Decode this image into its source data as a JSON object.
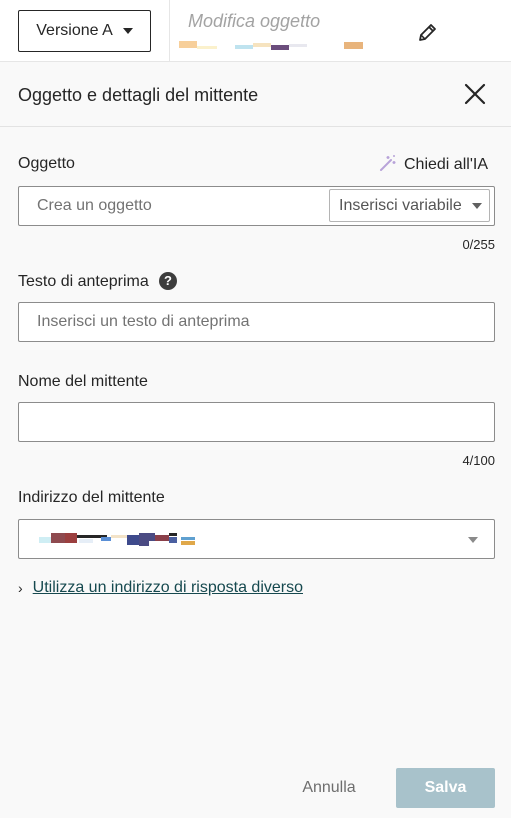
{
  "topbar": {
    "version_label": "Versione A",
    "subject_preview": "Modifica oggetto"
  },
  "panel": {
    "title": "Oggetto e dettagli del mittente"
  },
  "subject": {
    "label": "Oggetto",
    "ai_label": "Chiedi all'IA",
    "placeholder": "Crea un oggetto",
    "value": "",
    "insert_variable_label": "Inserisci variabile",
    "counter": "0/255"
  },
  "preview_text": {
    "label": "Testo di anteprima",
    "help_symbol": "?",
    "placeholder": "Inserisci un testo di anteprima",
    "value": ""
  },
  "sender_name": {
    "label": "Nome del mittente",
    "value": "",
    "counter": "4/100"
  },
  "sender_address": {
    "label": "Indirizzo del mittente"
  },
  "reply_link": {
    "chevron": "›",
    "label": "Utilizza un indirizzo di risposta diverso"
  },
  "footer": {
    "cancel_label": "Annulla",
    "save_label": "Salva"
  },
  "colors": {
    "link": "#16494f",
    "save_button_disabled": "#a8c2cb",
    "background": "#f9f9f9"
  }
}
